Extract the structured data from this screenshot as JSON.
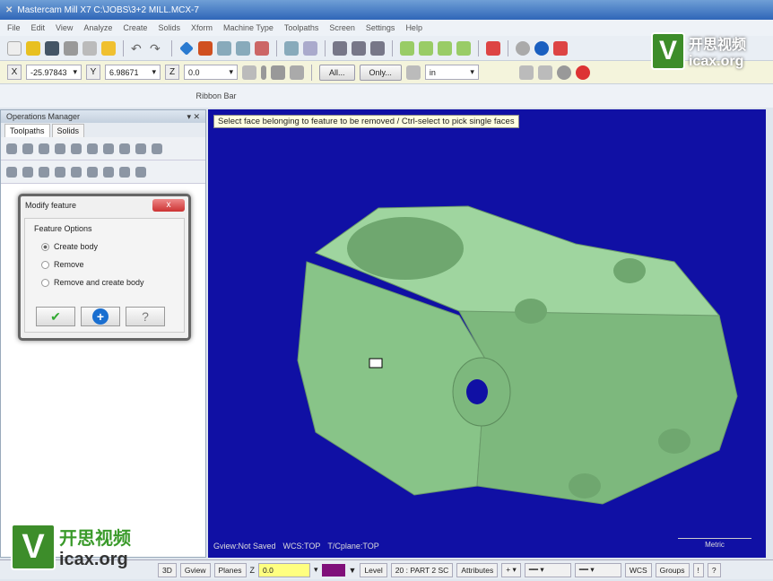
{
  "window": {
    "title": "Mastercam Mill X7  C:\\JOBS\\3+2 MILL.MCX-7"
  },
  "menu": [
    "File",
    "Edit",
    "View",
    "Analyze",
    "Create",
    "Solids",
    "Xform",
    "Machine Type",
    "Toolpaths",
    "Screen",
    "Settings",
    "Help"
  ],
  "coords": {
    "x_label": "X",
    "x": "-25.97843",
    "y_label": "Y",
    "y": "6.98671",
    "z_label": "Z",
    "z": "0.0",
    "all_button": "All...",
    "only_button": "Only...",
    "units": "in"
  },
  "ribbon": {
    "label": "Ribbon Bar"
  },
  "ops_manager": {
    "title": "Operations Manager",
    "tabs": [
      "Toolpaths",
      "Solids"
    ]
  },
  "dialog": {
    "title": "Modify feature",
    "close": "x",
    "group": "Feature Options",
    "options": [
      {
        "label": "Create body",
        "selected": true
      },
      {
        "label": "Remove",
        "selected": false
      },
      {
        "label": "Remove and create body",
        "selected": false
      }
    ],
    "ok": "✔",
    "add": "+",
    "help": "?"
  },
  "viewport": {
    "prompt": "Select face belonging to feature to be removed / Ctrl-select to pick single faces",
    "gview": "Gview:Not Saved",
    "wcs": "WCS:TOP",
    "tplane": "T/Cplane:TOP",
    "scale": "Metric"
  },
  "statusbar": {
    "mode": "3D",
    "gview": "Gview",
    "planes": "Planes",
    "z": "Z",
    "z_value": "0.0",
    "level_label": "Level",
    "level": "20 : PART 2 SC",
    "attributes": "Attributes",
    "wcs": "WCS",
    "groups": "Groups",
    "q1": "!",
    "q2": "?"
  },
  "watermark": {
    "brand": "开思视频",
    "site": "icax.org",
    "letter": "V"
  },
  "colors": {
    "viewport": "#1010a4",
    "part": "#8fcc8f"
  }
}
